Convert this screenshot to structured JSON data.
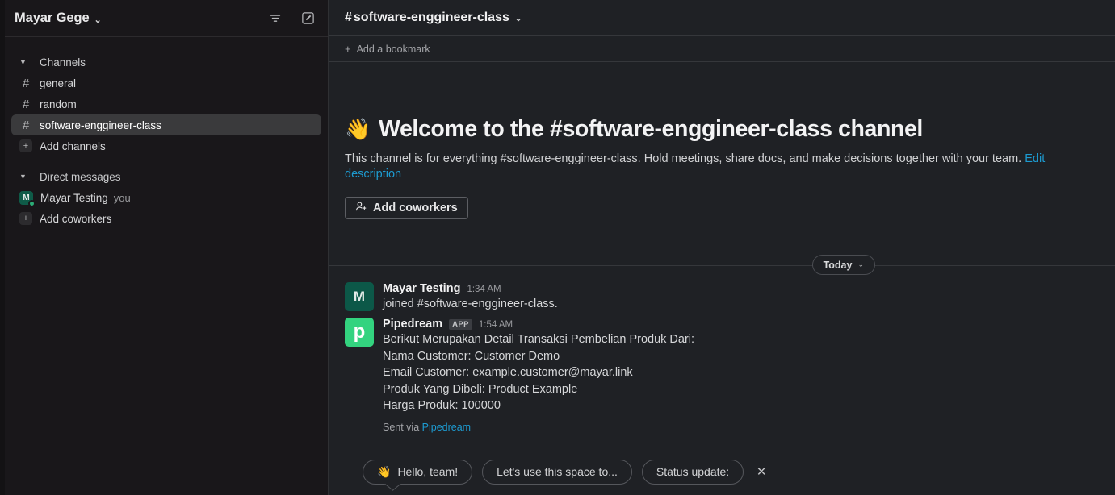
{
  "sidebar": {
    "workspace_title": "Mayar Gege",
    "workspace_caret": "⌄",
    "filter_icon": "filter-icon",
    "compose_icon": "compose-icon",
    "sections": [
      {
        "id": "channels",
        "label": "Channels",
        "caret": "▼",
        "items": [
          {
            "type": "channel",
            "prefix": "#",
            "label": "general",
            "selected": false
          },
          {
            "type": "channel",
            "prefix": "#",
            "label": "random",
            "selected": false
          },
          {
            "type": "channel",
            "prefix": "#",
            "label": "software-enggineer-class",
            "selected": true
          },
          {
            "type": "action",
            "prefix": "+",
            "label": "Add channels",
            "selected": false
          }
        ]
      },
      {
        "id": "direct-messages",
        "label": "Direct messages",
        "caret": "▼",
        "items": [
          {
            "type": "dm",
            "avatar_letter": "M",
            "label": "Mayar Testing",
            "suffix": "you",
            "selected": false
          },
          {
            "type": "action",
            "prefix": "+",
            "label": "Add coworkers",
            "selected": false
          }
        ]
      }
    ]
  },
  "channel_header": {
    "hash": "#",
    "name": "software-enggineer-class",
    "caret": "⌄",
    "bookmark_plus": "+",
    "bookmark_label": "Add a bookmark"
  },
  "welcome": {
    "emoji": "👋",
    "heading": "Welcome to the #software-enggineer-class channel",
    "description": "This channel is for everything #software-enggineer-class. Hold meetings, share docs, and make decisions together with your team.",
    "edit_link": "Edit description",
    "add_coworkers_label": "Add coworkers",
    "person_add_icon": "person-add-icon"
  },
  "divider": {
    "label": "Today",
    "caret": "⌄"
  },
  "messages": [
    {
      "author": "Mayar Testing",
      "avatar_letter": "M",
      "avatar_kind": "mayar",
      "badge": null,
      "time": "1:34 AM",
      "lines": [
        "joined #software-enggineer-class."
      ],
      "footer_prefix": null,
      "footer_link": null
    },
    {
      "author": "Pipedream",
      "avatar_letter": "p",
      "avatar_kind": "pipedream",
      "badge": "APP",
      "time": "1:54 AM",
      "lines": [
        "Berikut Merupakan Detail Transaksi Pembelian Produk Dari:",
        "Nama Customer: Customer Demo",
        "Email Customer: example.customer@mayar.link",
        "Produk Yang Dibeli: Product Example",
        "Harga Produk: 100000"
      ],
      "footer_prefix": "Sent via ",
      "footer_link": "Pipedream"
    }
  ],
  "suggestion_chips": {
    "items": [
      {
        "emoji": "👋",
        "label": "Hello, team!",
        "tail": true
      },
      {
        "emoji": null,
        "label": "Let's use this space to...",
        "tail": false
      },
      {
        "emoji": null,
        "label": "Status update:",
        "tail": false
      }
    ],
    "close_label": "✕"
  },
  "colors": {
    "sidebar_bg": "#19171a",
    "main_bg": "#1f2125",
    "selected_row": "#3a3a3c",
    "link": "#1d9bd1",
    "pipedream_green": "#33d37f",
    "mayar_green": "#0c5848",
    "presence_green": "#2bac76"
  }
}
